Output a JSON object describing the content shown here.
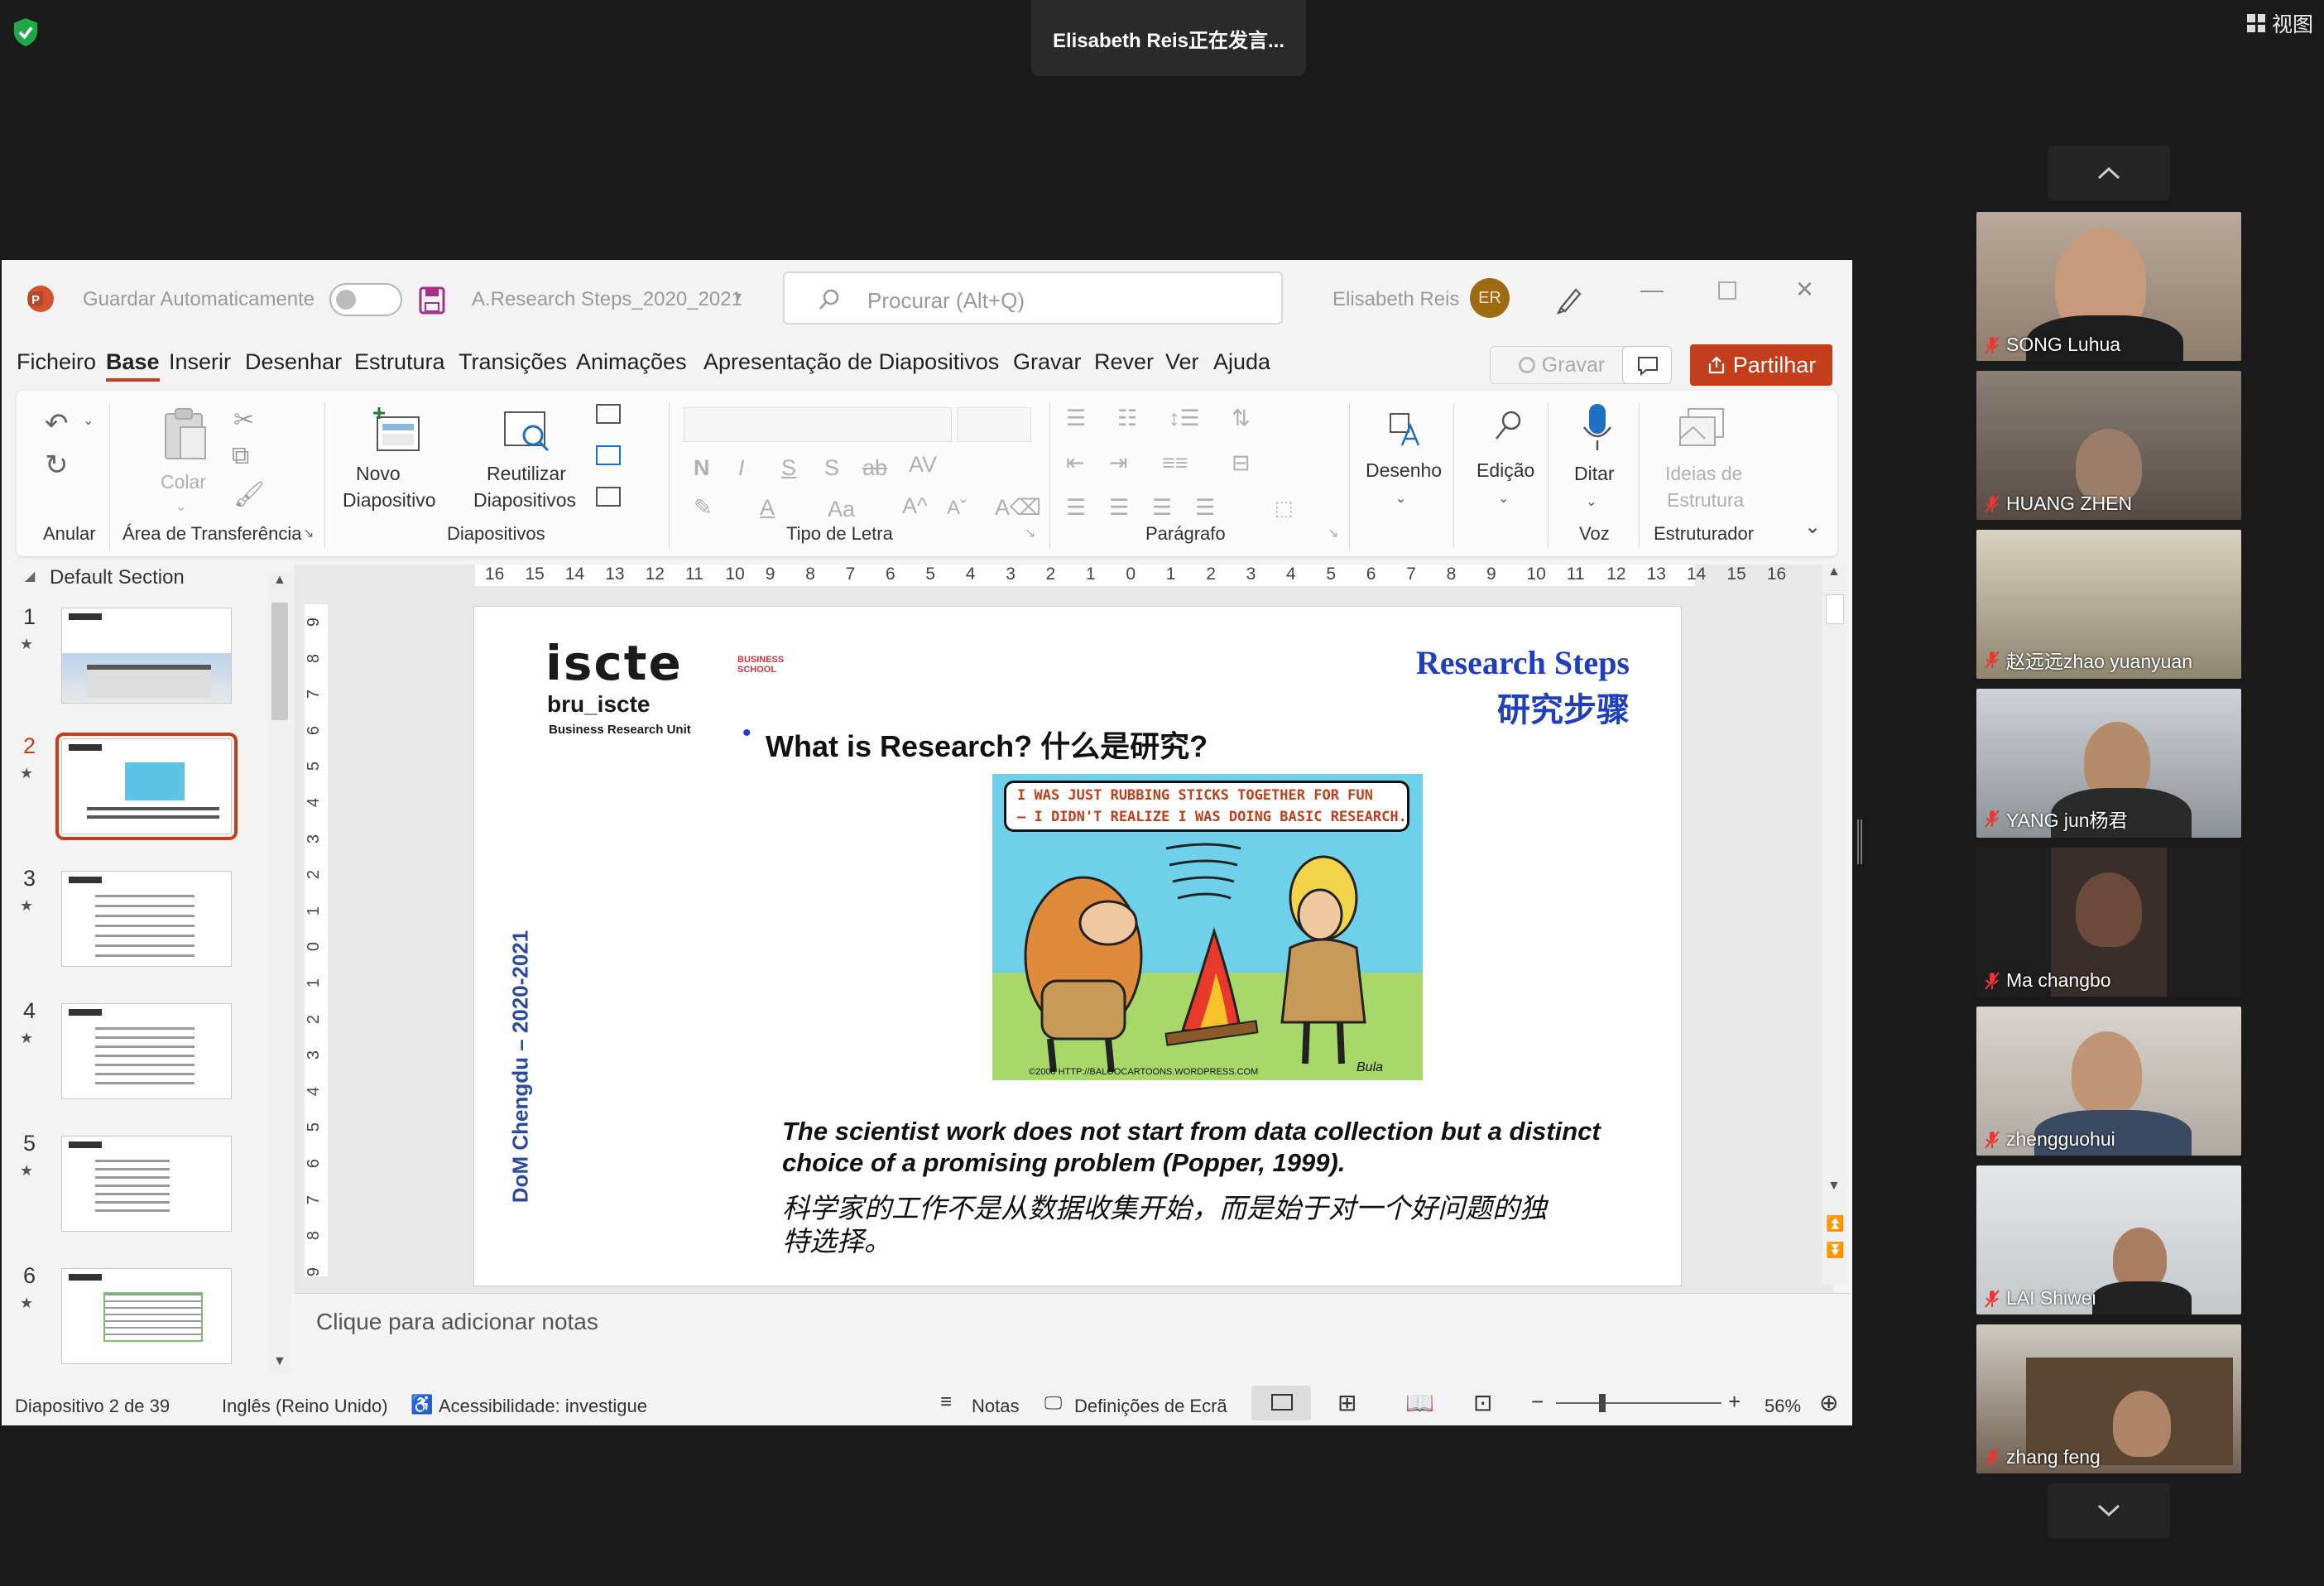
{
  "meeting": {
    "speaking_banner": "Elisabeth Reis正在发言...",
    "view_button": "视图",
    "participants": [
      {
        "name": "SONG Luhua"
      },
      {
        "name": "HUANG ZHEN"
      },
      {
        "name": "赵远远zhao yuanyuan"
      },
      {
        "name": "YANG jun杨君"
      },
      {
        "name": "Ma changbo"
      },
      {
        "name": "zhengguohui"
      },
      {
        "name": "LAI Shiwei"
      },
      {
        "name": "zhang feng"
      }
    ]
  },
  "ppt": {
    "autosave_label": "Guardar Automaticamente",
    "file_name": "A.Research Steps_2020_2021",
    "search_placeholder": "Procurar (Alt+Q)",
    "user_name": "Elisabeth Reis",
    "user_initials": "ER",
    "tabs": [
      "Ficheiro",
      "Base",
      "Inserir",
      "Desenhar",
      "Estrutura",
      "Transições",
      "Animações",
      "Apresentação de Diapositivos",
      "Gravar",
      "Rever",
      "Ver",
      "Ajuda"
    ],
    "record_button": "Gravar",
    "share_button": "Partilhar",
    "ribbon": {
      "paste": "Colar",
      "new_slide_1": "Novo",
      "new_slide_2": "Diapositivo",
      "reuse_1": "Reutilizar",
      "reuse_2": "Diapositivos",
      "draw": "Desenho",
      "edit": "Edição",
      "dictate": "Ditar",
      "designer_1": "Ideias de",
      "designer_2": "Estrutura",
      "groups": {
        "undo": "Anular",
        "clipboard": "Área de Transferência",
        "slides": "Diapositivos",
        "font": "Tipo de Letra",
        "paragraph": "Parágrafo",
        "voice": "Voz",
        "designer": "Estruturador"
      }
    },
    "section_name": "Default Section",
    "thumbnails": [
      "1",
      "2",
      "3",
      "4",
      "5",
      "6"
    ],
    "ruler_h": [
      "16",
      "15",
      "14",
      "13",
      "12",
      "11",
      "10",
      "9",
      "8",
      "7",
      "6",
      "5",
      "4",
      "3",
      "2",
      "1",
      "0",
      "1",
      "2",
      "3",
      "4",
      "5",
      "6",
      "7",
      "8",
      "9",
      "10",
      "11",
      "12",
      "13",
      "14",
      "15",
      "16"
    ],
    "ruler_v": [
      "9",
      "8",
      "7",
      "6",
      "5",
      "4",
      "3",
      "2",
      "1",
      "0",
      "1",
      "2",
      "3",
      "4",
      "5",
      "6",
      "7",
      "8",
      "9"
    ],
    "slide": {
      "logo_main": "iscte",
      "logo_business_1": "BUSINESS",
      "logo_business_2": "SCHOOL",
      "logo_bru": "bru_iscte",
      "logo_bru_sub": "Business Research Unit",
      "title_en": "Research Steps",
      "title_cn": "研究步骤",
      "bullet": "What is Research? 什么是研究?",
      "cartoon_caption_1": "I WAS JUST RUBBING STICKS TOGETHER FOR FUN",
      "cartoon_caption_2": "– I DIDN'T REALIZE I WAS DOING BASIC RESEARCH.",
      "cartoon_credit": "©2008 HTTP://BALOOCARTOONS.WORDPRESS.COM",
      "cartoon_sig": "Bula",
      "side_text": "DoM Chengdu – 2020-2021",
      "quote_en_1": "The scientist work does not start from data collection but a distinct",
      "quote_en_2": "choice of a promising problem (Popper, 1999).",
      "quote_cn_1": "科学家的工作不是从数据收集开始，而是始于对一个好问题的独",
      "quote_cn_2": "特选择。"
    },
    "notes_placeholder": "Clique para adicionar notas",
    "status": {
      "slide_of": "Diapositivo 2 de 39",
      "language": "Inglês (Reino Unido)",
      "accessibility": "Acessibilidade: investigue",
      "notes": "Notas",
      "display_settings": "Definições de Ecrã",
      "zoom": "56%"
    }
  },
  "colors": {
    "ppt_accent": "#c43e1c",
    "slide_title_blue": "#1f3fbf",
    "side_text_blue": "#2a4aa0"
  }
}
